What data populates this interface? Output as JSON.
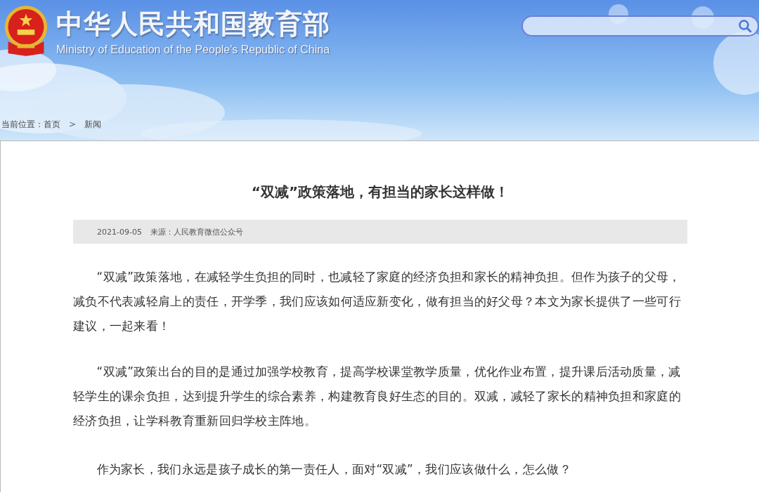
{
  "header": {
    "title": "中华人民共和国教育部",
    "subtitle": "Ministry of Education of the People's Republic of China"
  },
  "breadcrumb": {
    "label": "当前位置：",
    "items": [
      "首页",
      "新闻"
    ],
    "separator": ">"
  },
  "article": {
    "title": "“双减”政策落地，有担当的家长这样做！",
    "date": "2021-09-05",
    "source": "来源：人民教育微信公众号",
    "paragraphs": [
      "“双减”政策落地，在减轻学生负担的同时，也减轻了家庭的经济负担和家长的精神负担。但作为孩子的父母，减负不代表减轻肩上的责任，开学季，我们应该如何适应新变化，做有担当的好父母？本文为家长提供了一些可行建议，一起来看！",
      "“双减”政策出台的目的是通过加强学校教育，提高学校课堂教学质量，优化作业布置，提升课后活动质量，减轻学生的课余负担，达到提升学生的综合素养，构建教育良好生态的目的。双减，减轻了家长的精神负担和家庭的经济负担，让学科教育重新回归学校主阵地。",
      "作为家长，我们永远是孩子成长的第一责任人，面对“双减”，我们应该做什么，怎么做？"
    ]
  }
}
